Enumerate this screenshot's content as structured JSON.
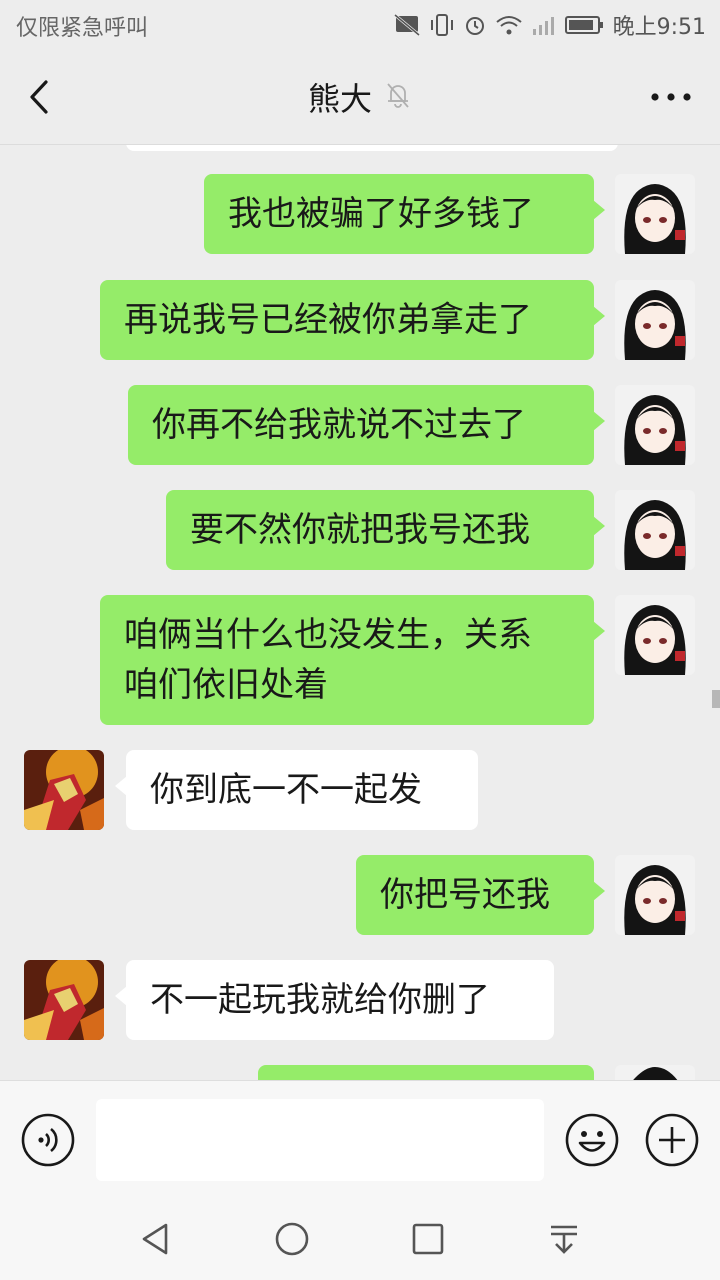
{
  "status_bar": {
    "carrier_text": "仅限紧急呼叫",
    "time": "晚上9:51"
  },
  "header": {
    "title": "熊大",
    "icons": {
      "back": "back-arrow-icon",
      "mute": "bell-muted-icon",
      "more": "more-dots-icon"
    }
  },
  "messages": [
    {
      "from": "me",
      "text": "我也被骗了好多钱了"
    },
    {
      "from": "me",
      "text": "再说我号已经被你弟拿走了"
    },
    {
      "from": "me",
      "text": "你再不给我就说不过去了"
    },
    {
      "from": "me",
      "text": "要不然你就把我号还我"
    },
    {
      "from": "me",
      "lines": [
        "咱俩当什么也没发生，关系",
        "咱们依旧处着"
      ]
    },
    {
      "from": "other",
      "text": "你到底一不一起发"
    },
    {
      "from": "me",
      "text": "你把号还我"
    },
    {
      "from": "other",
      "text": "不一起玩我就给你删了"
    }
  ],
  "input_bar": {
    "input_value": "",
    "icons": {
      "voice": "voice-icon",
      "emoji": "emoji-icon",
      "plus": "plus-icon"
    }
  },
  "nav_bar": {
    "icons": [
      "back-triangle-icon",
      "home-circle-icon",
      "recents-square-icon",
      "notification-pull-icon"
    ]
  },
  "colors": {
    "background": "#ededed",
    "my_bubble": "#95ec69",
    "other_bubble": "#ffffff"
  }
}
